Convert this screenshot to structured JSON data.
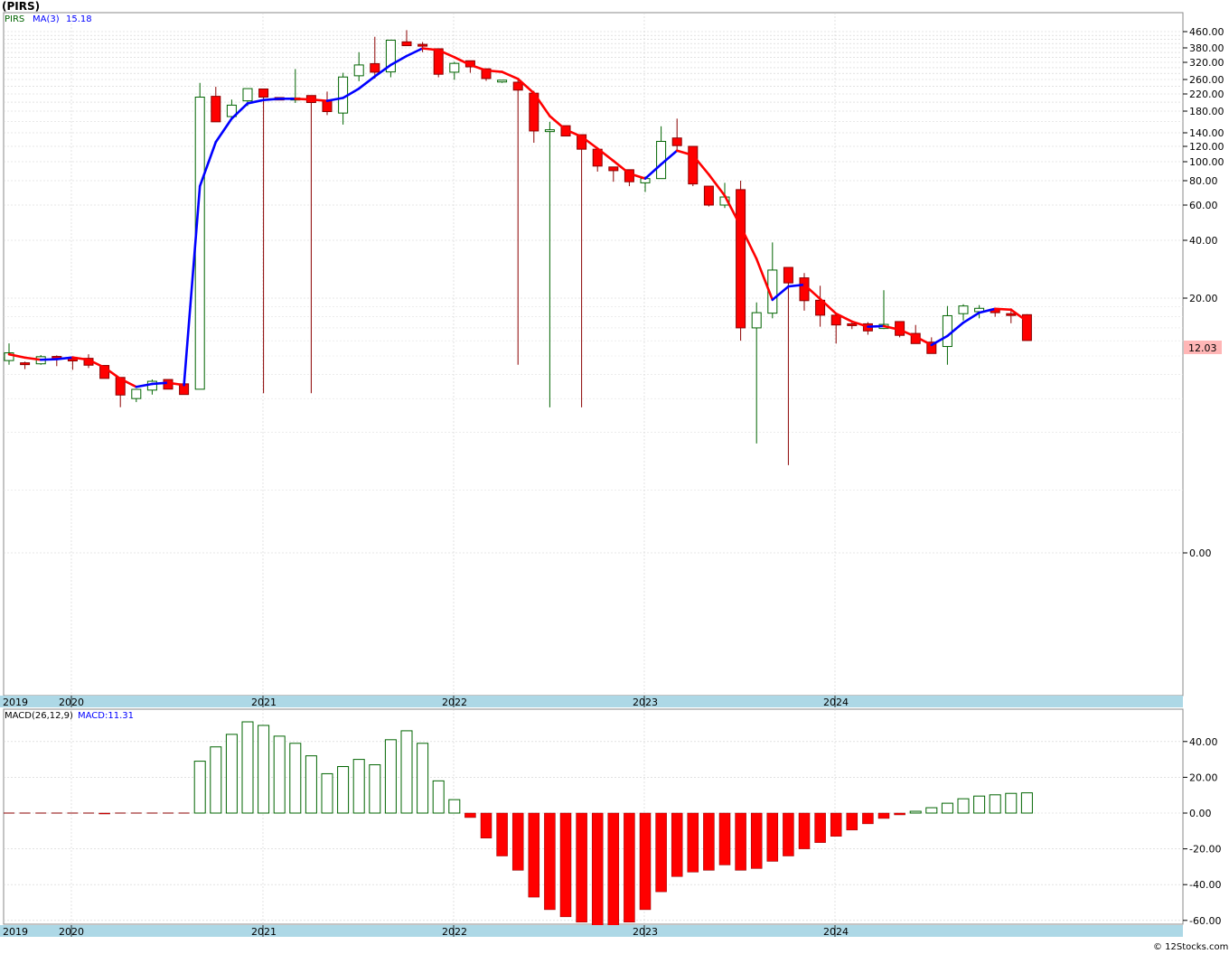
{
  "header": {
    "title": "(PIRS)"
  },
  "legend": {
    "symbol": "PIRS",
    "ma_label": "MA(3)",
    "ma_value": "15.18",
    "macd_label": "MACD(26,12,9)",
    "macd_value": "MACD:11.31"
  },
  "last_price_label": "12.03",
  "copyright": "© 12Stocks.com",
  "colors": {
    "up": "#006400",
    "down": "#ff0000",
    "ma_up": "#0000ff",
    "ma_down": "#ff0000",
    "axis_band": "#add8e6",
    "grid": "#c8c8c8"
  },
  "chart_data": [
    {
      "type": "candlestick",
      "scale": "log",
      "y_ticks": [
        0.0,
        20.0,
        40.0,
        60.0,
        80.0,
        100.0,
        120.0,
        140.0,
        180.0,
        220.0,
        260.0,
        320.0,
        380.0,
        460.0
      ],
      "y_tick_labels": [
        "0.00",
        "20.00",
        "40.00",
        "60.00",
        "80.00",
        "100.00",
        "120.00",
        "140.00",
        "180.00",
        "220.00",
        "260.00",
        "320.00",
        "380.00",
        "460.00"
      ],
      "x_labels": [
        "2019",
        "2020",
        "2021",
        "2022",
        "2023",
        "2024"
      ],
      "start": "2019-06",
      "ohlc": [
        [
          9.46,
          11.62,
          9.0,
          10.38
        ],
        [
          9.21,
          9.34,
          8.54,
          9.16
        ],
        [
          9.1,
          10.11,
          8.99,
          9.91
        ],
        [
          9.94,
          10.07,
          8.85,
          9.66
        ],
        [
          9.7,
          9.91,
          8.47,
          9.42
        ],
        [
          9.72,
          10.2,
          8.65,
          8.95
        ],
        [
          8.92,
          8.9,
          7.69,
          7.64
        ],
        [
          7.73,
          7.68,
          5.41,
          6.26
        ],
        [
          6.0,
          6.62,
          5.75,
          6.7
        ],
        [
          6.64,
          7.54,
          6.29,
          7.38
        ],
        [
          7.54,
          7.33,
          7.06,
          6.72
        ],
        [
          7.16,
          6.7,
          6.78,
          6.3
        ],
        [
          6.71,
          250.0,
          6.71,
          212.0
        ],
        [
          214.0,
          239.0,
          162.0,
          159.0
        ],
        [
          169.0,
          206.0,
          164.0,
          193.0
        ],
        [
          203.0,
          229.0,
          191.0,
          234.0
        ],
        [
          233.0,
          216.0,
          6.4,
          212.0
        ],
        [
          211.0,
          203.0,
          212.0,
          205.0
        ],
        [
          205.0,
          295.0,
          198.0,
          210.0
        ],
        [
          216.0,
          213.0,
          6.4,
          199.0
        ],
        [
          204.0,
          226.0,
          172.0,
          179.0
        ],
        [
          176.0,
          282.0,
          154.0,
          268.0
        ],
        [
          272.0,
          361.0,
          255.0,
          310.0
        ],
        [
          315.0,
          433.0,
          263.0,
          284.0
        ],
        [
          285.0,
          322.0,
          267.0,
          416.0
        ],
        [
          408.0,
          468.0,
          403.0,
          390.0
        ],
        [
          396.0,
          407.0,
          361.0,
          394.0
        ],
        [
          376.0,
          371.0,
          267.0,
          277.0
        ],
        [
          284.0,
          322.0,
          259.0,
          316.0
        ],
        [
          326.0,
          316.0,
          282.0,
          303.0
        ],
        [
          296.0,
          297.0,
          256.0,
          263.0
        ],
        [
          255.0,
          242.0,
          250.0,
          258.0
        ],
        [
          252.0,
          263.0,
          9.0,
          230.0
        ],
        [
          222.0,
          228.0,
          125.0,
          143.0
        ],
        [
          142.0,
          159.0,
          5.4,
          145.0
        ],
        [
          152.0,
          147.0,
          146.0,
          135.0
        ],
        [
          137.0,
          126.0,
          5.4,
          116.0
        ],
        [
          116.0,
          116.0,
          89.0,
          95.0
        ],
        [
          94.0,
          93.0,
          79.0,
          90.0
        ],
        [
          91.0,
          86.0,
          75.0,
          79.0
        ],
        [
          78.0,
          84.0,
          70.0,
          82.0
        ],
        [
          82.0,
          151.0,
          82.0,
          127.0
        ],
        [
          132.0,
          165.0,
          115.0,
          121.0
        ],
        [
          120.0,
          117.0,
          75.0,
          77.0
        ],
        [
          75.0,
          72.0,
          59.0,
          60.0
        ],
        [
          60.0,
          78.0,
          58.0,
          66.0
        ],
        [
          72.0,
          80.0,
          12.0,
          14.0
        ],
        [
          14.0,
          19.0,
          3.5,
          16.8
        ],
        [
          16.7,
          39.0,
          15.7,
          28.0
        ],
        [
          28.9,
          24.0,
          2.7,
          24.0
        ],
        [
          25.5,
          27.0,
          17.2,
          19.4
        ],
        [
          19.5,
          23.2,
          14.2,
          16.3
        ],
        [
          16.3,
          15.6,
          11.6,
          14.5
        ],
        [
          14.7,
          15.2,
          13.8,
          14.6
        ],
        [
          14.7,
          15.0,
          12.9,
          13.5
        ],
        [
          13.9,
          22.0,
          13.8,
          14.6
        ],
        [
          15.1,
          15.0,
          12.5,
          12.8
        ],
        [
          13.1,
          14.5,
          11.8,
          11.6
        ],
        [
          11.8,
          12.5,
          10.8,
          10.3
        ],
        [
          11.2,
          18.2,
          9.0,
          16.2
        ],
        [
          16.6,
          18.6,
          15.3,
          18.2
        ],
        [
          17.0,
          18.4,
          15.7,
          17.7
        ],
        [
          17.5,
          17.3,
          16.0,
          16.8
        ],
        [
          16.6,
          17.7,
          14.8,
          16.5
        ],
        [
          16.4,
          16.5,
          12.0,
          12.03
        ]
      ],
      "ma3": [
        10.2,
        9.8,
        9.55,
        9.62,
        9.82,
        9.55,
        8.7,
        7.6,
        6.9,
        7.15,
        7.25,
        7.05,
        75.0,
        126.0,
        165.0,
        197.0,
        205.0,
        208.0,
        208.0,
        206.0,
        203.0,
        210.0,
        234.0,
        270.0,
        310.0,
        345.0,
        378.0,
        370.0,
        340.0,
        310.0,
        290.0,
        285.0,
        262.0,
        222.0,
        170.0,
        145.0,
        134.0,
        117.0,
        101.0,
        87.0,
        82.0,
        97.0,
        114.0,
        108.0,
        86.0,
        67.0,
        47.0,
        32.0,
        19.6,
        23.0,
        23.5,
        19.8,
        16.6,
        15.1,
        14.2,
        14.3,
        13.7,
        12.6,
        11.4,
        12.7,
        14.9,
        16.8,
        17.6,
        17.4,
        15.18
      ]
    },
    {
      "type": "bar",
      "title": "MACD(26,12,9)",
      "y_ticks": [
        -60.0,
        -40.0,
        -20.0,
        0.0,
        20.0,
        40.0
      ],
      "y_tick_labels": [
        "-60.00",
        "-40.00",
        "-20.00",
        "0.00",
        "20.00",
        "40.00"
      ],
      "x_labels": [
        "2019",
        "2020",
        "2021",
        "2022",
        "2023",
        "2024"
      ],
      "values": [
        0.0,
        0.0,
        0.0,
        0.0,
        0.0,
        0.0,
        -0.3,
        0.0,
        0.0,
        0.0,
        0.0,
        0.0,
        29.0,
        37.0,
        44.0,
        51.0,
        49.0,
        43.0,
        39.0,
        32.0,
        22.0,
        26.0,
        30.0,
        27.0,
        41.0,
        46.0,
        39.0,
        18.0,
        7.5,
        -2.5,
        -14.0,
        -24.0,
        -32.0,
        -47.0,
        -54.0,
        -58.0,
        -61.0,
        -63.0,
        -63.0,
        -61.0,
        -54.0,
        -44.0,
        -35.5,
        -33.0,
        -32.0,
        -29.0,
        -32.0,
        -31.0,
        -27.0,
        -24.0,
        -20.0,
        -16.5,
        -13.0,
        -9.5,
        -6.0,
        -3.0,
        -1.0,
        1.0,
        3.0,
        5.5,
        8.0,
        9.5,
        10.2,
        11.0,
        11.31
      ]
    }
  ]
}
